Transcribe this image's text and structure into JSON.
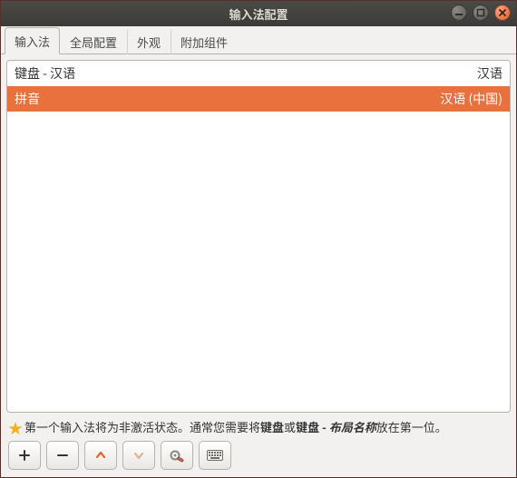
{
  "window": {
    "title": "输入法配置"
  },
  "tabs": [
    {
      "label": "输入法",
      "active": true
    },
    {
      "label": "全局配置",
      "active": false
    },
    {
      "label": "外观",
      "active": false
    },
    {
      "label": "附加组件",
      "active": false
    }
  ],
  "list": {
    "rows": [
      {
        "left": "键盘 - 汉语",
        "right": "汉语",
        "selected": false
      },
      {
        "left": "拼音",
        "right": "汉语 (中国)",
        "selected": true
      }
    ]
  },
  "hint": {
    "pre": "第一个输入法将为非激活状态。通常您需要将",
    "bold1": "键盘",
    "mid": "或",
    "bold2": "键盘 - ",
    "boldItalic": "布局名称",
    "post": "放在第一位。"
  },
  "toolbar": {
    "add": "add-button",
    "remove": "remove-button",
    "moveUp": "move-up-button",
    "moveDown": "move-down-button",
    "config": "configure-button",
    "keyboard": "keyboard-button"
  },
  "icons": {
    "minimize": "minimize-icon",
    "maximize": "maximize-icon",
    "close": "close-icon",
    "star": "star-icon"
  }
}
